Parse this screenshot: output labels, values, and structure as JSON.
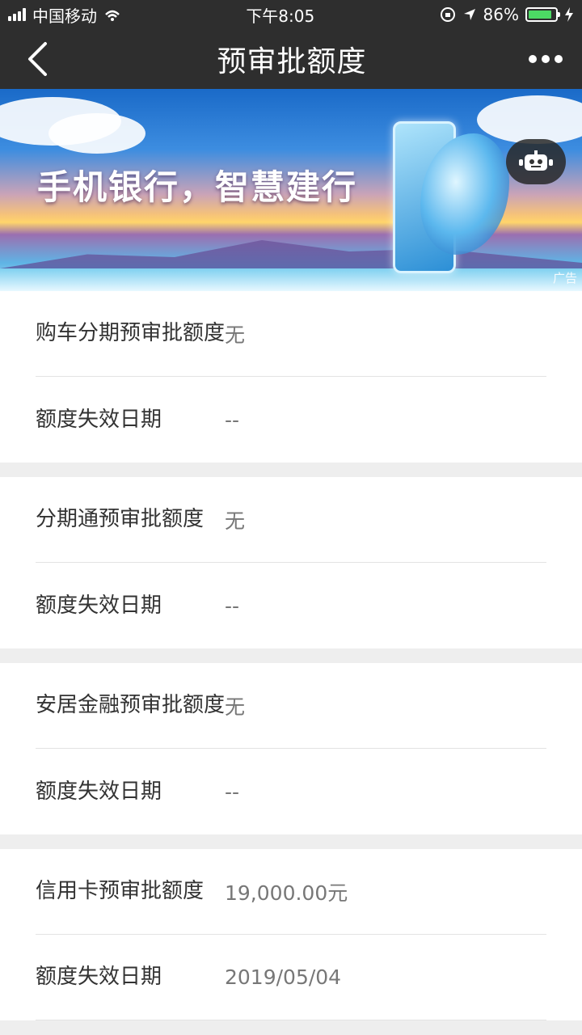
{
  "status_bar": {
    "carrier": "中国移动",
    "time": "下午8:05",
    "battery_percent": "86%",
    "battery_level": 0.86,
    "battery_color": "#4cd964"
  },
  "nav": {
    "title": "预审批额度",
    "back_icon": "chevron-left-icon",
    "more_icon": "more-dots-icon"
  },
  "banner": {
    "slogan": "手机银行，智慧建行",
    "ad_label": "广告",
    "robot_icon": "robot-icon"
  },
  "sections": [
    {
      "limit_label": "购车分期预审批额度",
      "limit_value": "无",
      "date_label": "额度失效日期",
      "date_value": "--"
    },
    {
      "limit_label": "分期通预审批额度",
      "limit_value": "无",
      "date_label": "额度失效日期",
      "date_value": "--"
    },
    {
      "limit_label": "安居金融预审批额度",
      "limit_value": "无",
      "date_label": "额度失效日期",
      "date_value": "--"
    },
    {
      "limit_label": "信用卡预审批额度",
      "limit_value": "19,000.00元",
      "date_label": "额度失效日期",
      "date_value": "2019/05/04"
    }
  ]
}
